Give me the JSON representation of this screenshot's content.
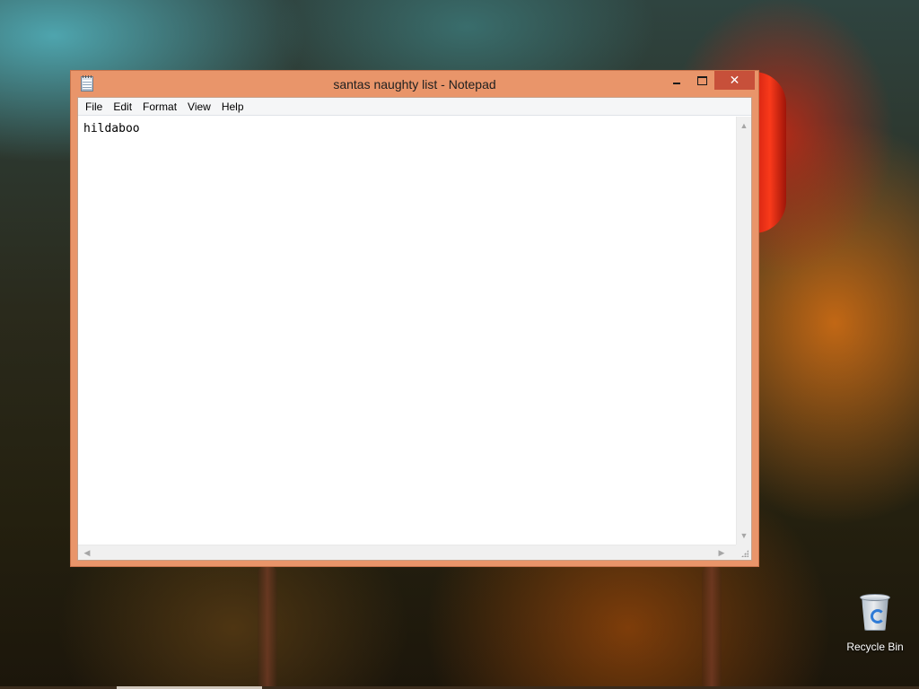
{
  "window": {
    "title": "santas naughty list - Notepad",
    "controls": {
      "minimize": "",
      "maximize": "",
      "close": "✕"
    }
  },
  "menu": {
    "items": [
      {
        "label": "File"
      },
      {
        "label": "Edit"
      },
      {
        "label": "Format"
      },
      {
        "label": "View"
      },
      {
        "label": "Help"
      }
    ]
  },
  "document": {
    "text": "hildaboo"
  },
  "scrollbars": {
    "up": "▲",
    "down": "▼",
    "left": "◀",
    "right": "▶"
  },
  "desktop": {
    "icons": [
      {
        "label": "Recycle Bin",
        "icon": "recycle-bin-icon"
      }
    ]
  },
  "theme": {
    "window_frame": "#e9956a",
    "close_button": "#c7503a"
  }
}
